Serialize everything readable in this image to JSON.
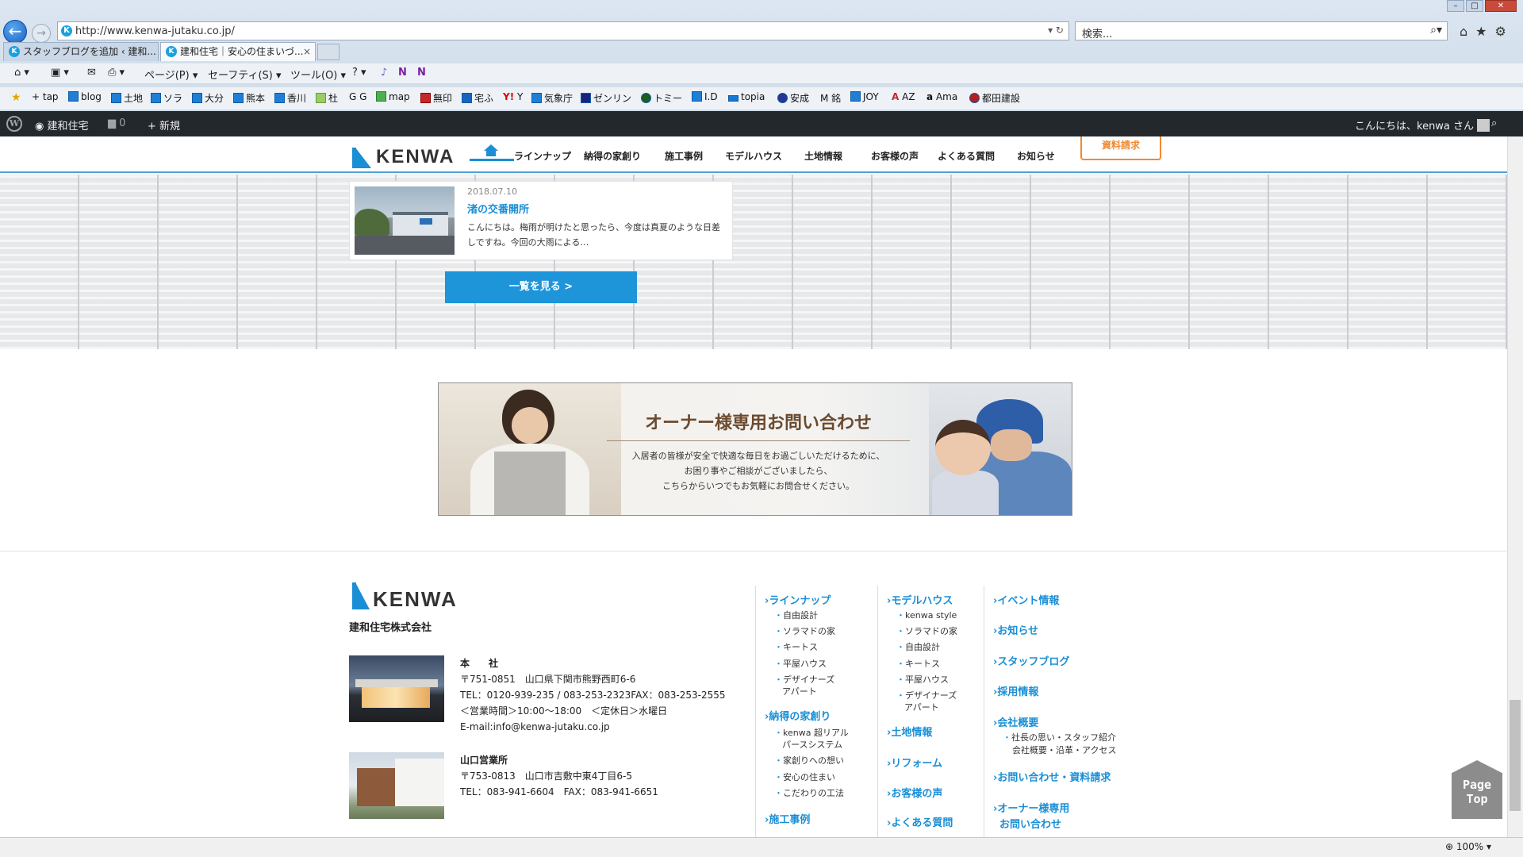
{
  "browser": {
    "url": "http://www.kenwa-jutaku.co.jp/",
    "search_placeholder": "検索...",
    "tabs": [
      {
        "label": "スタッフブログを追加 ‹ 建和..."
      },
      {
        "label": "建和住宅｜安心の住まいづ..."
      }
    ],
    "commands": [
      "ページ(P)",
      "セーフティ(S)",
      "ツール(O)"
    ],
    "favorites": [
      "tap",
      "blog",
      "土地",
      "ソラ",
      "大分",
      "熊本",
      "香川",
      "杜",
      "G",
      "map",
      "無印",
      "宅ふ",
      "Y",
      "気象庁",
      "ゼンリン",
      "トミー",
      "I.D",
      "topia",
      "安成",
      "銘",
      "JOY",
      "AZ",
      "Ama",
      "都田建設"
    ],
    "zoom": "100%"
  },
  "wp_admin": {
    "site_name": "建和住宅",
    "comments_count": "0",
    "new_label": "新規",
    "greeting": "こんにちは、kenwa さん"
  },
  "header": {
    "logo_text": "KENWA",
    "nav": [
      "ラインナップ",
      "納得の家創り",
      "施工事例",
      "モデルハウス",
      "土地情報",
      "お客様の声",
      "よくある質問",
      "お知らせ"
    ],
    "doc_button": "資料請求"
  },
  "blog": {
    "date": "2018.07.10",
    "title": "渚の交番開所",
    "excerpt": "こんにちは。梅雨が明けたと思ったら、今度は真夏のような日差しですね。今回の大雨による…",
    "more_button": "一覧を見る >"
  },
  "owner_banner": {
    "title": "オーナー様専用お問い合わせ",
    "lines": [
      "入居者の皆様が安全で快適な毎日をお過ごしいただけるために、",
      "お困り事やご相談がございましたら、",
      "こちらからいつでもお気軽にお問合せください。"
    ]
  },
  "footer": {
    "logo_text": "KENWA",
    "company": "建和住宅株式会社",
    "offices": [
      {
        "name": "本　　社",
        "lines": [
          "〒751-0851　山口県下関市熊野西町6-6",
          "TEL：0120-939-235 / 083-253-2323FAX：083-253-2555",
          "＜営業時間＞10:00～18:00　＜定休日＞水曜日",
          "E-mail:info@kenwa-jutaku.co.jp"
        ]
      },
      {
        "name": "山口営業所",
        "lines": [
          "〒753-0813　山口市吉敷中東4丁目6-5",
          "TEL：083-941-6604　FAX：083-941-6651"
        ]
      }
    ],
    "col1": {
      "h1": "ラインナップ",
      "items1": [
        "自由設計",
        "ソラマドの家",
        "キートス",
        "平屋ハウス",
        "デザイナーズ",
        "アパート"
      ],
      "h2": "納得の家創り",
      "items2": [
        "kenwa 超リアル",
        "パースシステム",
        "家創りへの想い",
        "安心の住まい",
        "こだわりの工法"
      ],
      "h3": "施工事例"
    },
    "col2": {
      "h1": "モデルハウス",
      "items1": [
        "kenwa style",
        "ソラマドの家",
        "自由設計",
        "キートス",
        "平屋ハウス",
        "デザイナーズ",
        "アパート"
      ],
      "h2": "土地情報",
      "h3": "リフォーム",
      "h4": "お客様の声",
      "h5": "よくある質問"
    },
    "col3": {
      "h1": "イベント情報",
      "h2": "お知らせ",
      "h3": "スタッフブログ",
      "h4": "採用情報",
      "h5": "会社概要",
      "items5": [
        "社長の思い・スタッフ紹介",
        "会社概要・沿革・アクセス"
      ],
      "h6": "お問い合わせ・資料請求",
      "h7": "オーナー様専用",
      "h7b": "お問い合わせ"
    },
    "pagetop_1": "Page",
    "pagetop_2": "Top"
  }
}
